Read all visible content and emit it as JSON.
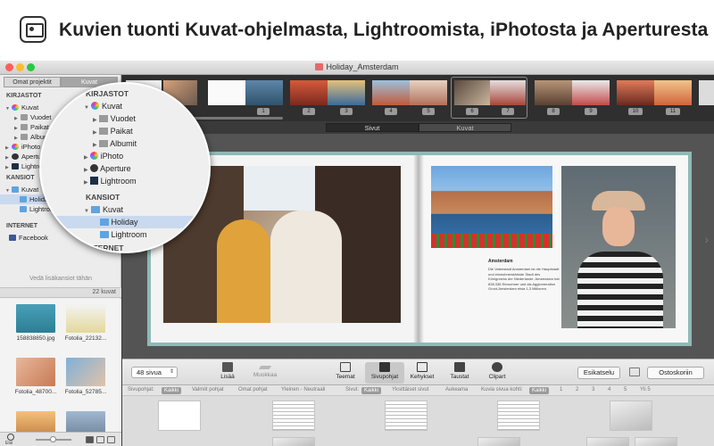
{
  "headline": {
    "title": "Kuvien tuonti Kuvat-ohjelmasta, Lightroomista, iPhotosta ja Aperturesta"
  },
  "window": {
    "title": "Holiday_Amsterdam"
  },
  "sidebar": {
    "tabs": [
      "Omat projektit",
      "Kuvat"
    ],
    "sections": {
      "kirjastot": "KIRJASTOT",
      "kansiot": "KANSIOT",
      "internet": "INTERNET"
    },
    "library_items": [
      {
        "label": "Kuvat",
        "indent": 0
      },
      {
        "label": "Vuodet",
        "indent": 1
      },
      {
        "label": "Paikat",
        "indent": 1
      },
      {
        "label": "Albumit",
        "indent": 1
      },
      {
        "label": "iPhoto",
        "indent": 0
      },
      {
        "label": "Aperture",
        "indent": 0
      },
      {
        "label": "Lightroom",
        "indent": 0
      }
    ],
    "folder_items": [
      {
        "label": "Kuvat",
        "indent": 0
      },
      {
        "label": "Holiday",
        "indent": 1
      },
      {
        "label": "Lightroom",
        "indent": 1
      }
    ],
    "internet_items": [
      {
        "label": "Facebook"
      }
    ],
    "drop_hint": "Vedä lisäkansiot tähän",
    "photo_count": "22 kuvat",
    "thumbnails": [
      {
        "label": "158838850.jpg"
      },
      {
        "label": "Fotolia_22132..."
      },
      {
        "label": "Fotolia_48700..."
      },
      {
        "label": "Fotolia_52785..."
      }
    ],
    "search_label": "Etsi"
  },
  "zoom": {
    "section_kirjastot": "KIRJASTOT",
    "library_items": [
      {
        "label": "Kuvat"
      },
      {
        "label": "Vuodet"
      },
      {
        "label": "Paikat"
      },
      {
        "label": "Albumit"
      },
      {
        "label": "iPhoto"
      },
      {
        "label": "Aperture"
      },
      {
        "label": "Lightroom"
      }
    ],
    "section_kansiot": "KANSIOT",
    "folder_items": [
      {
        "label": "Kuvat"
      },
      {
        "label": "Holiday"
      },
      {
        "label": "Lightroom"
      }
    ],
    "section_internet": "INTERNET",
    "internet_items": [
      {
        "label": "Facebook"
      }
    ]
  },
  "page_strip": {
    "page_numbers": [
      "1",
      "2",
      "3",
      "4",
      "5",
      "6",
      "7",
      "8",
      "9",
      "10",
      "11"
    ]
  },
  "view_tabs": {
    "pages": "Sivut",
    "photos": "Kuvat"
  },
  "spread": {
    "text_title": "Amsterdam",
    "text_body": "Die Vatenstadt Amsterdam ist die Hauptstadt und einwohnerstärkste Stadt des Königreichs der Niederlande. Amsterdam hat 838.338 Einwohner und als Agglomeration Groot-Amsterdam etwa 1,3 Millionen."
  },
  "toolbar": {
    "pages_select": "48 sivua",
    "tools": [
      {
        "label": "Lisää",
        "icon": "add-icon"
      },
      {
        "label": "Muokkaa",
        "icon": "edit-icon"
      },
      {
        "label": "Teemat",
        "icon": "themes-icon"
      },
      {
        "label": "Sivupohjat",
        "icon": "layouts-icon"
      },
      {
        "label": "Kehykset",
        "icon": "frames-icon"
      },
      {
        "label": "Taustat",
        "icon": "backgrounds-icon"
      },
      {
        "label": "Clipart",
        "icon": "clipart-icon"
      }
    ],
    "preview_button": "Esikatselu",
    "cart_button": "Ostoskoriin"
  },
  "filters": {
    "label": "Sivupohjat:",
    "all_pill": "Kaikki",
    "ready": "Valmiit pohjat",
    "own": "Omat pohjat",
    "general": "Yleinen - Neutraali",
    "pages_label": "Sivut:",
    "pages_all": "Kaikki",
    "single_pages": "Yksittäiset sivut",
    "spread_label": "Aukeama",
    "photos_per_page_label": "Kuvia sivua kohti:",
    "photos_all": "Kaikki",
    "counts": [
      "1",
      "2",
      "3",
      "4",
      "5",
      "Yli 5"
    ]
  },
  "colors": {
    "spread_border": "#8fb9b7",
    "selection_blue": "#c9d9ef",
    "dark_bg": "#3c3c3c"
  }
}
